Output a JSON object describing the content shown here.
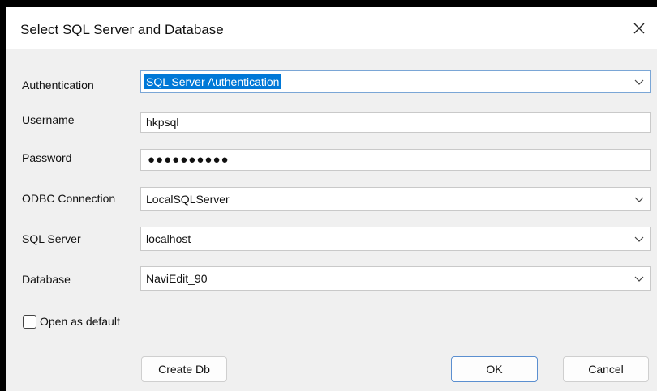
{
  "dialog": {
    "title": "Select SQL Server and Database",
    "close_icon": "close-icon"
  },
  "form": {
    "authentication": {
      "label": "Authentication",
      "value": "SQL Server Authentication"
    },
    "username": {
      "label": "Username",
      "value": "hkpsql"
    },
    "password": {
      "label": "Password",
      "value": "●●●●●●●●●●"
    },
    "odbc_connection": {
      "label": "ODBC Connection",
      "value": "LocalSQLServer"
    },
    "sql_server": {
      "label": "SQL Server",
      "value": "localhost"
    },
    "database": {
      "label": "Database",
      "value": "NaviEdit_90"
    }
  },
  "options": {
    "open_as_default": {
      "label": "Open as default",
      "checked": false
    }
  },
  "buttons": {
    "create_db": "Create Db",
    "ok": "OK",
    "cancel": "Cancel"
  },
  "colors": {
    "selection": "#0078d7",
    "dialog_bg": "#f0f0f0",
    "ok_border": "#5b8fd0"
  }
}
